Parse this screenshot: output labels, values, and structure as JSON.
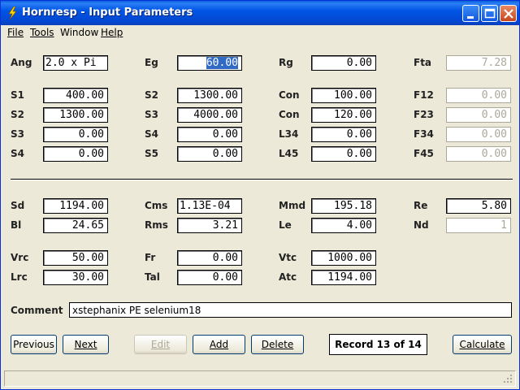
{
  "window": {
    "title": "Hornresp - Input Parameters",
    "icon": "lightning-bolt-icon",
    "controls": [
      "minimize-icon",
      "maximize-icon",
      "close-icon"
    ]
  },
  "menu": {
    "file": "File",
    "tools": "Tools",
    "window": "Window",
    "help": "Help"
  },
  "params": {
    "ang": {
      "label": "Ang",
      "value": "2.0 x Pi"
    },
    "eg": {
      "label": "Eg",
      "value": "60.00"
    },
    "rg": {
      "label": "Rg",
      "value": "0.00"
    },
    "fta": {
      "label": "Fta",
      "value": "7.28"
    },
    "s1": {
      "label": "S1",
      "value": "400.00"
    },
    "s2a": {
      "label": "S2",
      "value": "1300.00"
    },
    "con1": {
      "label": "Con",
      "value": "100.00"
    },
    "f12": {
      "label": "F12",
      "value": "0.00"
    },
    "s2b": {
      "label": "S2",
      "value": "1300.00"
    },
    "s3a": {
      "label": "S3",
      "value": "4000.00"
    },
    "con2": {
      "label": "Con",
      "value": "120.00"
    },
    "f23": {
      "label": "F23",
      "value": "0.00"
    },
    "s3b": {
      "label": "S3",
      "value": "0.00"
    },
    "s4a": {
      "label": "S4",
      "value": "0.00"
    },
    "l34": {
      "label": "L34",
      "value": "0.00"
    },
    "f34": {
      "label": "F34",
      "value": "0.00"
    },
    "s4b": {
      "label": "S4",
      "value": "0.00"
    },
    "s5": {
      "label": "S5",
      "value": "0.00"
    },
    "l45": {
      "label": "L45",
      "value": "0.00"
    },
    "f45": {
      "label": "F45",
      "value": "0.00"
    },
    "sd": {
      "label": "Sd",
      "value": "1194.00"
    },
    "cms": {
      "label": "Cms",
      "value": "1.13E-04"
    },
    "mmd": {
      "label": "Mmd",
      "value": "195.18"
    },
    "re": {
      "label": "Re",
      "value": "5.80"
    },
    "bl": {
      "label": "Bl",
      "value": "24.65"
    },
    "rms": {
      "label": "Rms",
      "value": "3.21"
    },
    "le": {
      "label": "Le",
      "value": "4.00"
    },
    "nd": {
      "label": "Nd",
      "value": "1"
    },
    "vrc": {
      "label": "Vrc",
      "value": "50.00"
    },
    "fr": {
      "label": "Fr",
      "value": "0.00"
    },
    "vtc": {
      "label": "Vtc",
      "value": "1000.00"
    },
    "lrc": {
      "label": "Lrc",
      "value": "30.00"
    },
    "tal": {
      "label": "Tal",
      "value": "0.00"
    },
    "atc": {
      "label": "Atc",
      "value": "1194.00"
    }
  },
  "comment": {
    "label": "Comment",
    "value": "xstephanix PE selenium18"
  },
  "buttons": {
    "previous": "Previous",
    "next": "Next",
    "edit": "Edit",
    "add": "Add",
    "delete": "Delete",
    "calculate": "Calculate"
  },
  "record": "Record 13 of 14",
  "colors": {
    "titlebar": "#0055e5",
    "face": "#ece9d8",
    "selection": "#316ac5",
    "disabled_text": "#aca899"
  }
}
